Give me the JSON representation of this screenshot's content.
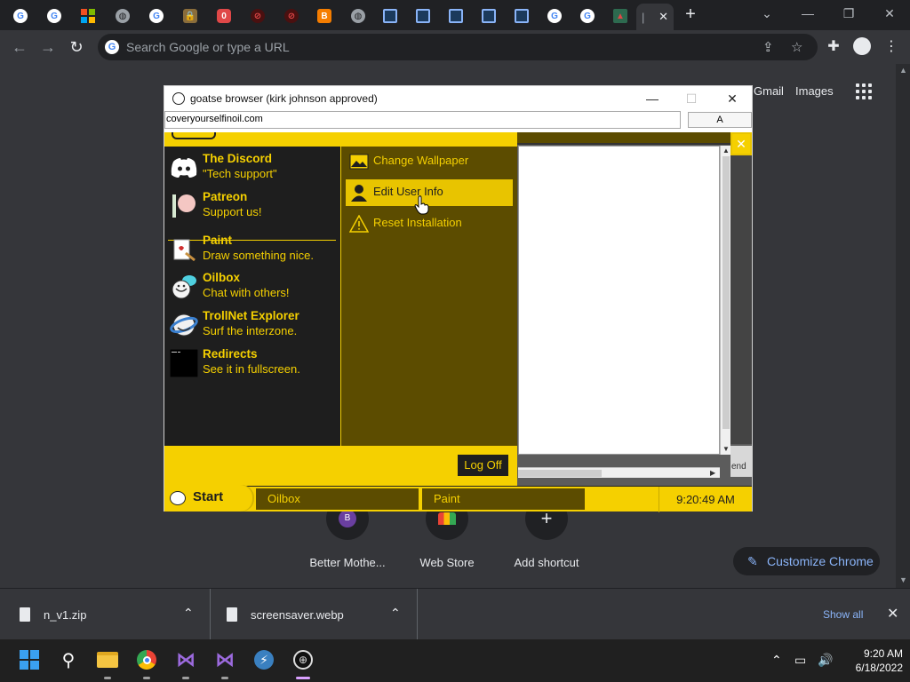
{
  "chrome": {
    "tabs": [
      {
        "icon": "google-icon"
      },
      {
        "icon": "google-icon"
      },
      {
        "icon": "microsoft-icon"
      },
      {
        "icon": "globe-icon"
      },
      {
        "icon": "google-icon"
      },
      {
        "icon": "lock-icon"
      },
      {
        "icon": "red-app-icon"
      },
      {
        "icon": "red-wifi-icon"
      },
      {
        "icon": "red-wifi-icon"
      },
      {
        "icon": "blogger-icon"
      },
      {
        "icon": "globe-icon"
      },
      {
        "icon": "window-icon"
      },
      {
        "icon": "window-icon"
      },
      {
        "icon": "window-icon"
      },
      {
        "icon": "window-icon"
      },
      {
        "icon": "window-icon"
      },
      {
        "icon": "google-icon"
      },
      {
        "icon": "google-icon"
      },
      {
        "icon": "photo-icon"
      }
    ],
    "active_tab_close": "✕",
    "new_tab": "+",
    "omnibox_placeholder": "Search Google or type a URL"
  },
  "ntp": {
    "gmail": "Gmail",
    "images": "Images",
    "shortcuts": [
      {
        "label": "Better Mothe...",
        "letter": "B"
      },
      {
        "label": "Web Store",
        "letter": ""
      },
      {
        "label": "Add shortcut",
        "letter": "+"
      }
    ],
    "customize": "Customize Chrome"
  },
  "downloads": {
    "items": [
      "n_v1.zip",
      "screensaver.webp"
    ],
    "show_all": "Show all"
  },
  "taskbar": {
    "time": "9:20 AM",
    "date": "6/18/2022"
  },
  "goatse_window": {
    "title": "goatse browser (kirk johnson approved)",
    "url": "coveryourselfinoil.com",
    "url_button": "A",
    "apps": [
      {
        "name": "The Discord",
        "desc": "\"Tech support\"",
        "icon": "discord-icon"
      },
      {
        "name": "Patreon",
        "desc": "Support us!",
        "icon": "patreon-icon"
      },
      {
        "name": "Paint",
        "desc": "Draw something nice.",
        "icon": "paint-icon"
      },
      {
        "name": "Oilbox",
        "desc": "Chat with others!",
        "icon": "oilbox-icon"
      },
      {
        "name": "TrollNet Explorer",
        "desc": "Surf the interzone.",
        "icon": "trollnet-icon"
      },
      {
        "name": "Redirects",
        "desc": "See it in fullscreen.",
        "icon": "terminal-icon"
      }
    ],
    "options": [
      {
        "label": "Change Wallpaper",
        "icon": "wallpaper-icon",
        "highlighted": false
      },
      {
        "label": "Edit User Info",
        "icon": "user-icon",
        "highlighted": true
      },
      {
        "label": "Reset Installation",
        "icon": "warning-icon",
        "highlighted": false
      }
    ],
    "log_off": "Log Off",
    "start": "Start",
    "task_buttons": [
      "Oilbox",
      "Paint"
    ],
    "clock": "9:20:49 AM",
    "pane_end_text": "end",
    "colors": {
      "accent": "#f5d000",
      "panel_dark": "#1e1e1e",
      "panel_olive": "#5c4c00"
    }
  }
}
